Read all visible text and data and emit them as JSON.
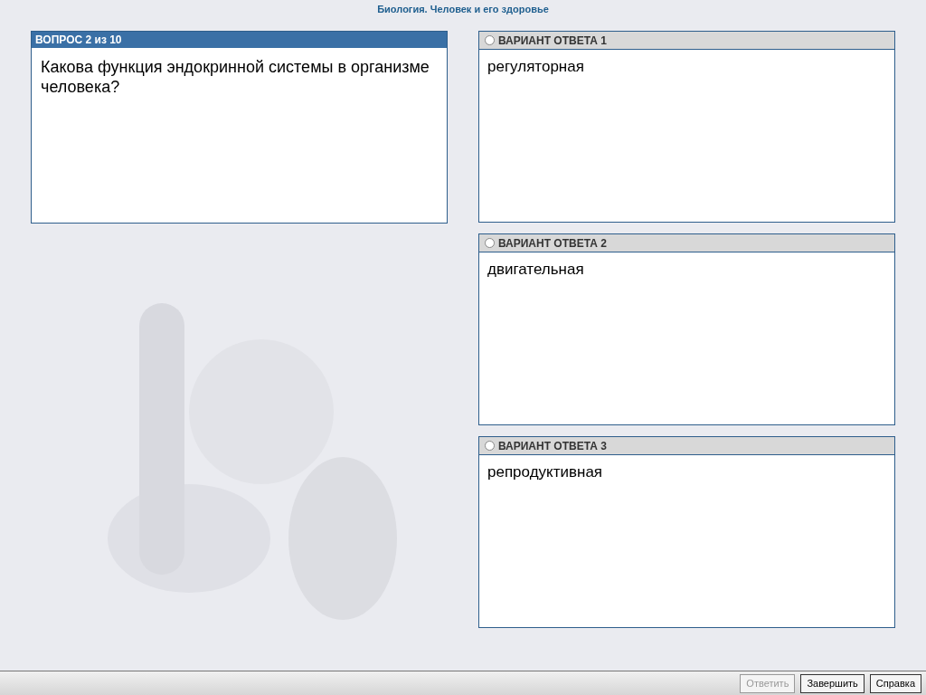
{
  "title": "Биология. Человек и его здоровье",
  "question": {
    "header": "ВОПРОС 2 из 10",
    "text": "Какова функция эндокринной системы в организме человека?"
  },
  "answers": [
    {
      "label": "ВАРИАНТ ОТВЕТА 1",
      "text": "регуляторная",
      "selected": false
    },
    {
      "label": "ВАРИАНТ ОТВЕТА 2",
      "text": "двигательная",
      "selected": false
    },
    {
      "label": "ВАРИАНТ ОТВЕТА 3",
      "text": "репродуктивная",
      "selected": false
    }
  ],
  "buttons": [
    {
      "label": "Ответить",
      "disabled": true
    },
    {
      "label": "Завершить",
      "disabled": false
    },
    {
      "label": "Справка",
      "disabled": false
    }
  ]
}
